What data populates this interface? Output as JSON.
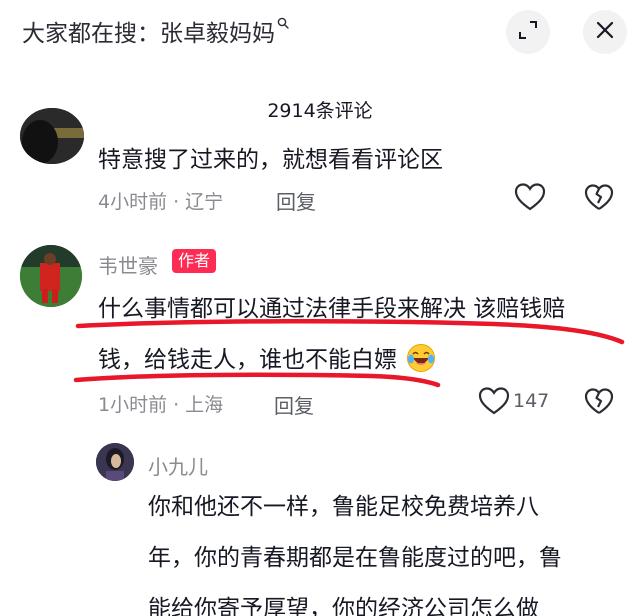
{
  "search": {
    "prefix": "大家都在搜：",
    "keyword": "张卓毅妈妈"
  },
  "header": {
    "comment_count": "2914条评论"
  },
  "comments": [
    {
      "text": "特意搜了过来的，就想看看评论区",
      "time": "4小时前",
      "location": "辽宁",
      "reply_label": "回复"
    },
    {
      "username": "韦世豪",
      "badge": "作者",
      "text_line1": "什么事情都可以通过法律手段来解决 该赔钱赔",
      "text_line2": "钱，给钱走人，谁也不能白嫖",
      "time": "1小时前",
      "location": "上海",
      "reply_label": "回复",
      "likes": "147"
    }
  ],
  "replies": [
    {
      "username": "小九儿",
      "text_line1": "你和他还不一样，鲁能足校免费培养八",
      "text_line2": "年，你的青春期都是在鲁能度过的吧，鲁",
      "text_line3": "能给你寄予厚望，你的经济公司怎么做"
    }
  ],
  "colors": {
    "accent_red": "#fe2c55",
    "underline_red": "#e8172a",
    "meta_gray": "#8a8b91"
  }
}
